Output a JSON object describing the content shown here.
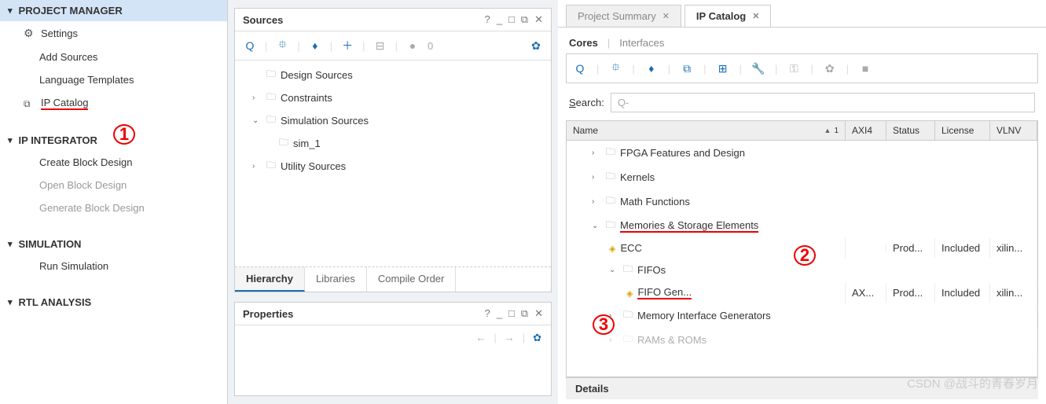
{
  "nav": {
    "project_manager": "PROJECT MANAGER",
    "settings": "Settings",
    "add_sources": "Add Sources",
    "language_templates": "Language Templates",
    "ip_catalog": "IP Catalog",
    "ip_integrator": "IP INTEGRATOR",
    "create_block": "Create Block Design",
    "open_block": "Open Block Design",
    "generate_block": "Generate Block Design",
    "simulation": "SIMULATION",
    "run_simulation": "Run Simulation",
    "rtl_analysis": "RTL ANALYSIS"
  },
  "sources": {
    "title": "Sources",
    "count": "0",
    "design_sources": "Design Sources",
    "constraints": "Constraints",
    "simulation_sources": "Simulation Sources",
    "sim_1": "sim_1",
    "utility_sources": "Utility Sources",
    "tab_hierarchy": "Hierarchy",
    "tab_libraries": "Libraries",
    "tab_compile": "Compile Order"
  },
  "properties": {
    "title": "Properties"
  },
  "right": {
    "tab_summary": "Project Summary",
    "tab_catalog": "IP Catalog",
    "subtab_cores": "Cores",
    "subtab_interfaces": "Interfaces",
    "search_label_pre": "S",
    "search_label_post": "earch:",
    "search_placeholder": "Q-",
    "col_name": "Name",
    "col_sort": "1",
    "col_axi": "AXI4",
    "col_status": "Status",
    "col_license": "License",
    "col_vlnv": "VLNV",
    "row_fpga": "FPGA Features and Design",
    "row_kernels": "Kernels",
    "row_math": "Math Functions",
    "row_memories": "Memories & Storage Elements",
    "row_ecc": "ECC",
    "row_ecc_status": "Prod...",
    "row_ecc_lic": "Included",
    "row_ecc_vlnv": "xilin...",
    "row_fifos": "FIFOs",
    "row_fifogen": "FIFO Gen...",
    "row_fifogen_axi": "AX...",
    "row_fifogen_status": "Prod...",
    "row_fifogen_lic": "Included",
    "row_fifogen_vlnv": "xilin...",
    "row_mig": "Memory Interface Generators",
    "row_rams": "RAMs & ROMs",
    "details": "Details"
  },
  "annotations": {
    "a1": "1",
    "a2": "2",
    "a3": "3"
  },
  "watermark": "CSDN @战斗的青春岁月"
}
